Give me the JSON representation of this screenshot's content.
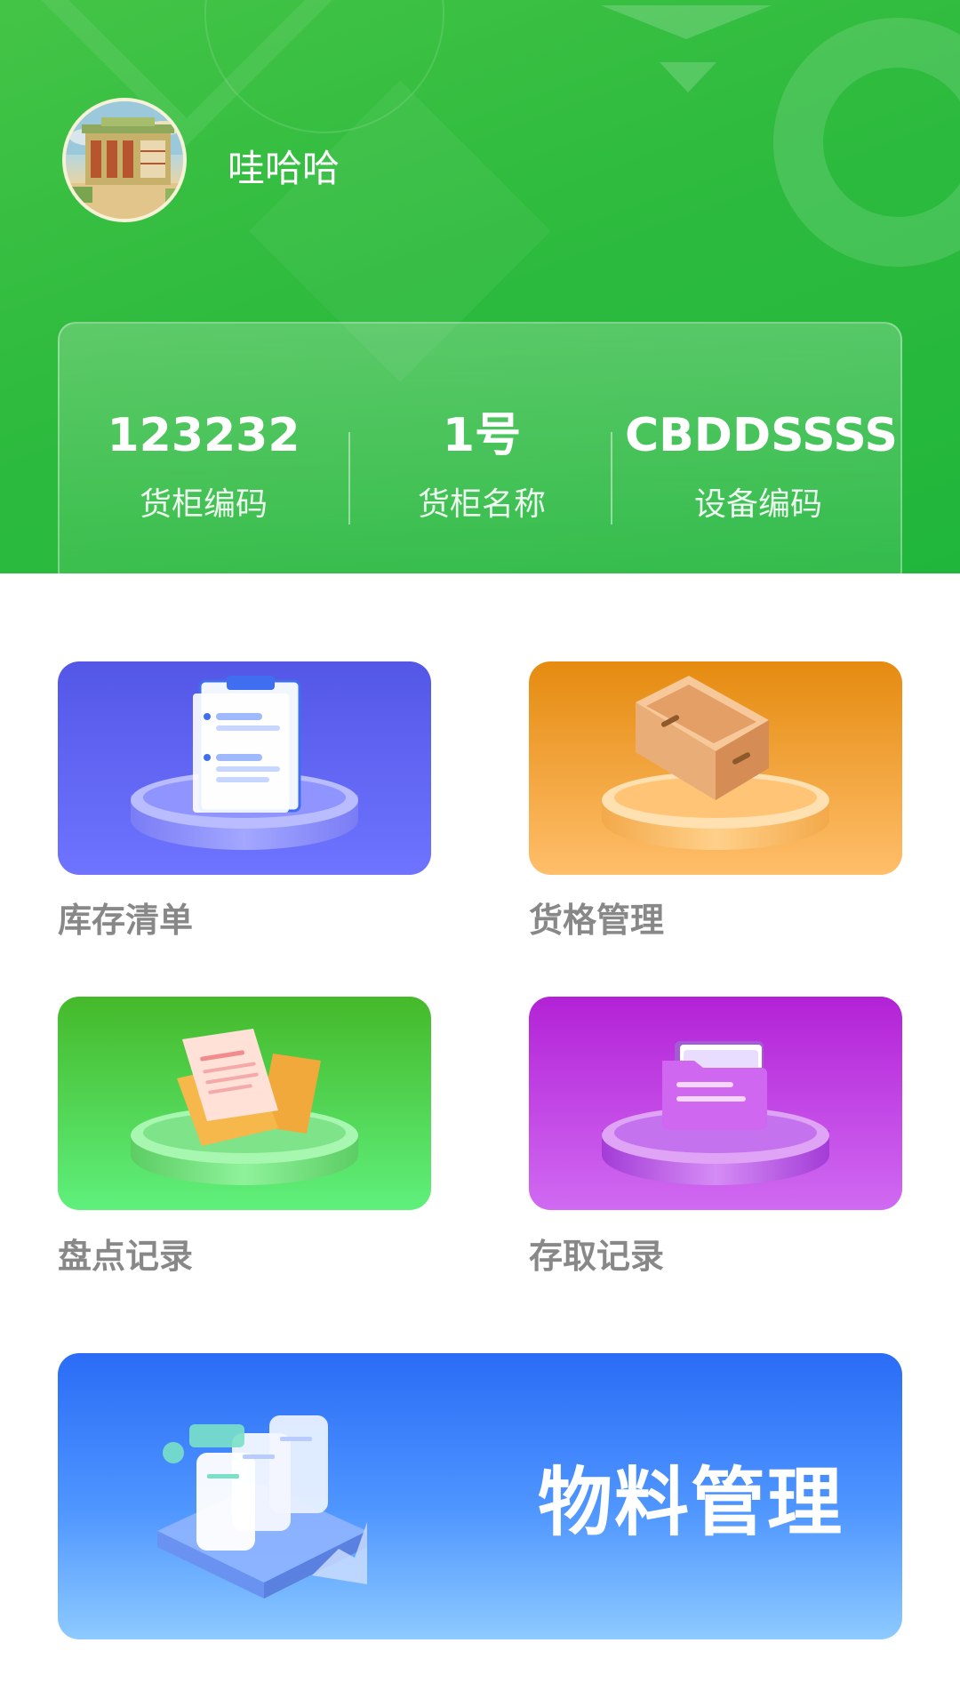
{
  "user": {
    "name": "哇哈哈"
  },
  "cabinet": {
    "items": [
      {
        "value": "123232",
        "label": "货柜编码"
      },
      {
        "value": "1号",
        "label": "货柜名称"
      },
      {
        "value": "CBDDSSSS",
        "label": "设备编码"
      }
    ]
  },
  "menu": {
    "tiles": [
      {
        "label": "库存清单",
        "icon": "clipboard-list-icon",
        "color": "#5b5ff0"
      },
      {
        "label": "货格管理",
        "icon": "open-box-icon",
        "color": "#f0a030"
      },
      {
        "label": "盘点记录",
        "icon": "documents-folder-icon",
        "color": "#4cd05a"
      },
      {
        "label": "存取记录",
        "icon": "folder-icon",
        "color": "#c040e0"
      }
    ]
  },
  "banner": {
    "title": "物料管理",
    "icon": "document-stack-icon",
    "color": "#3a82ff"
  }
}
